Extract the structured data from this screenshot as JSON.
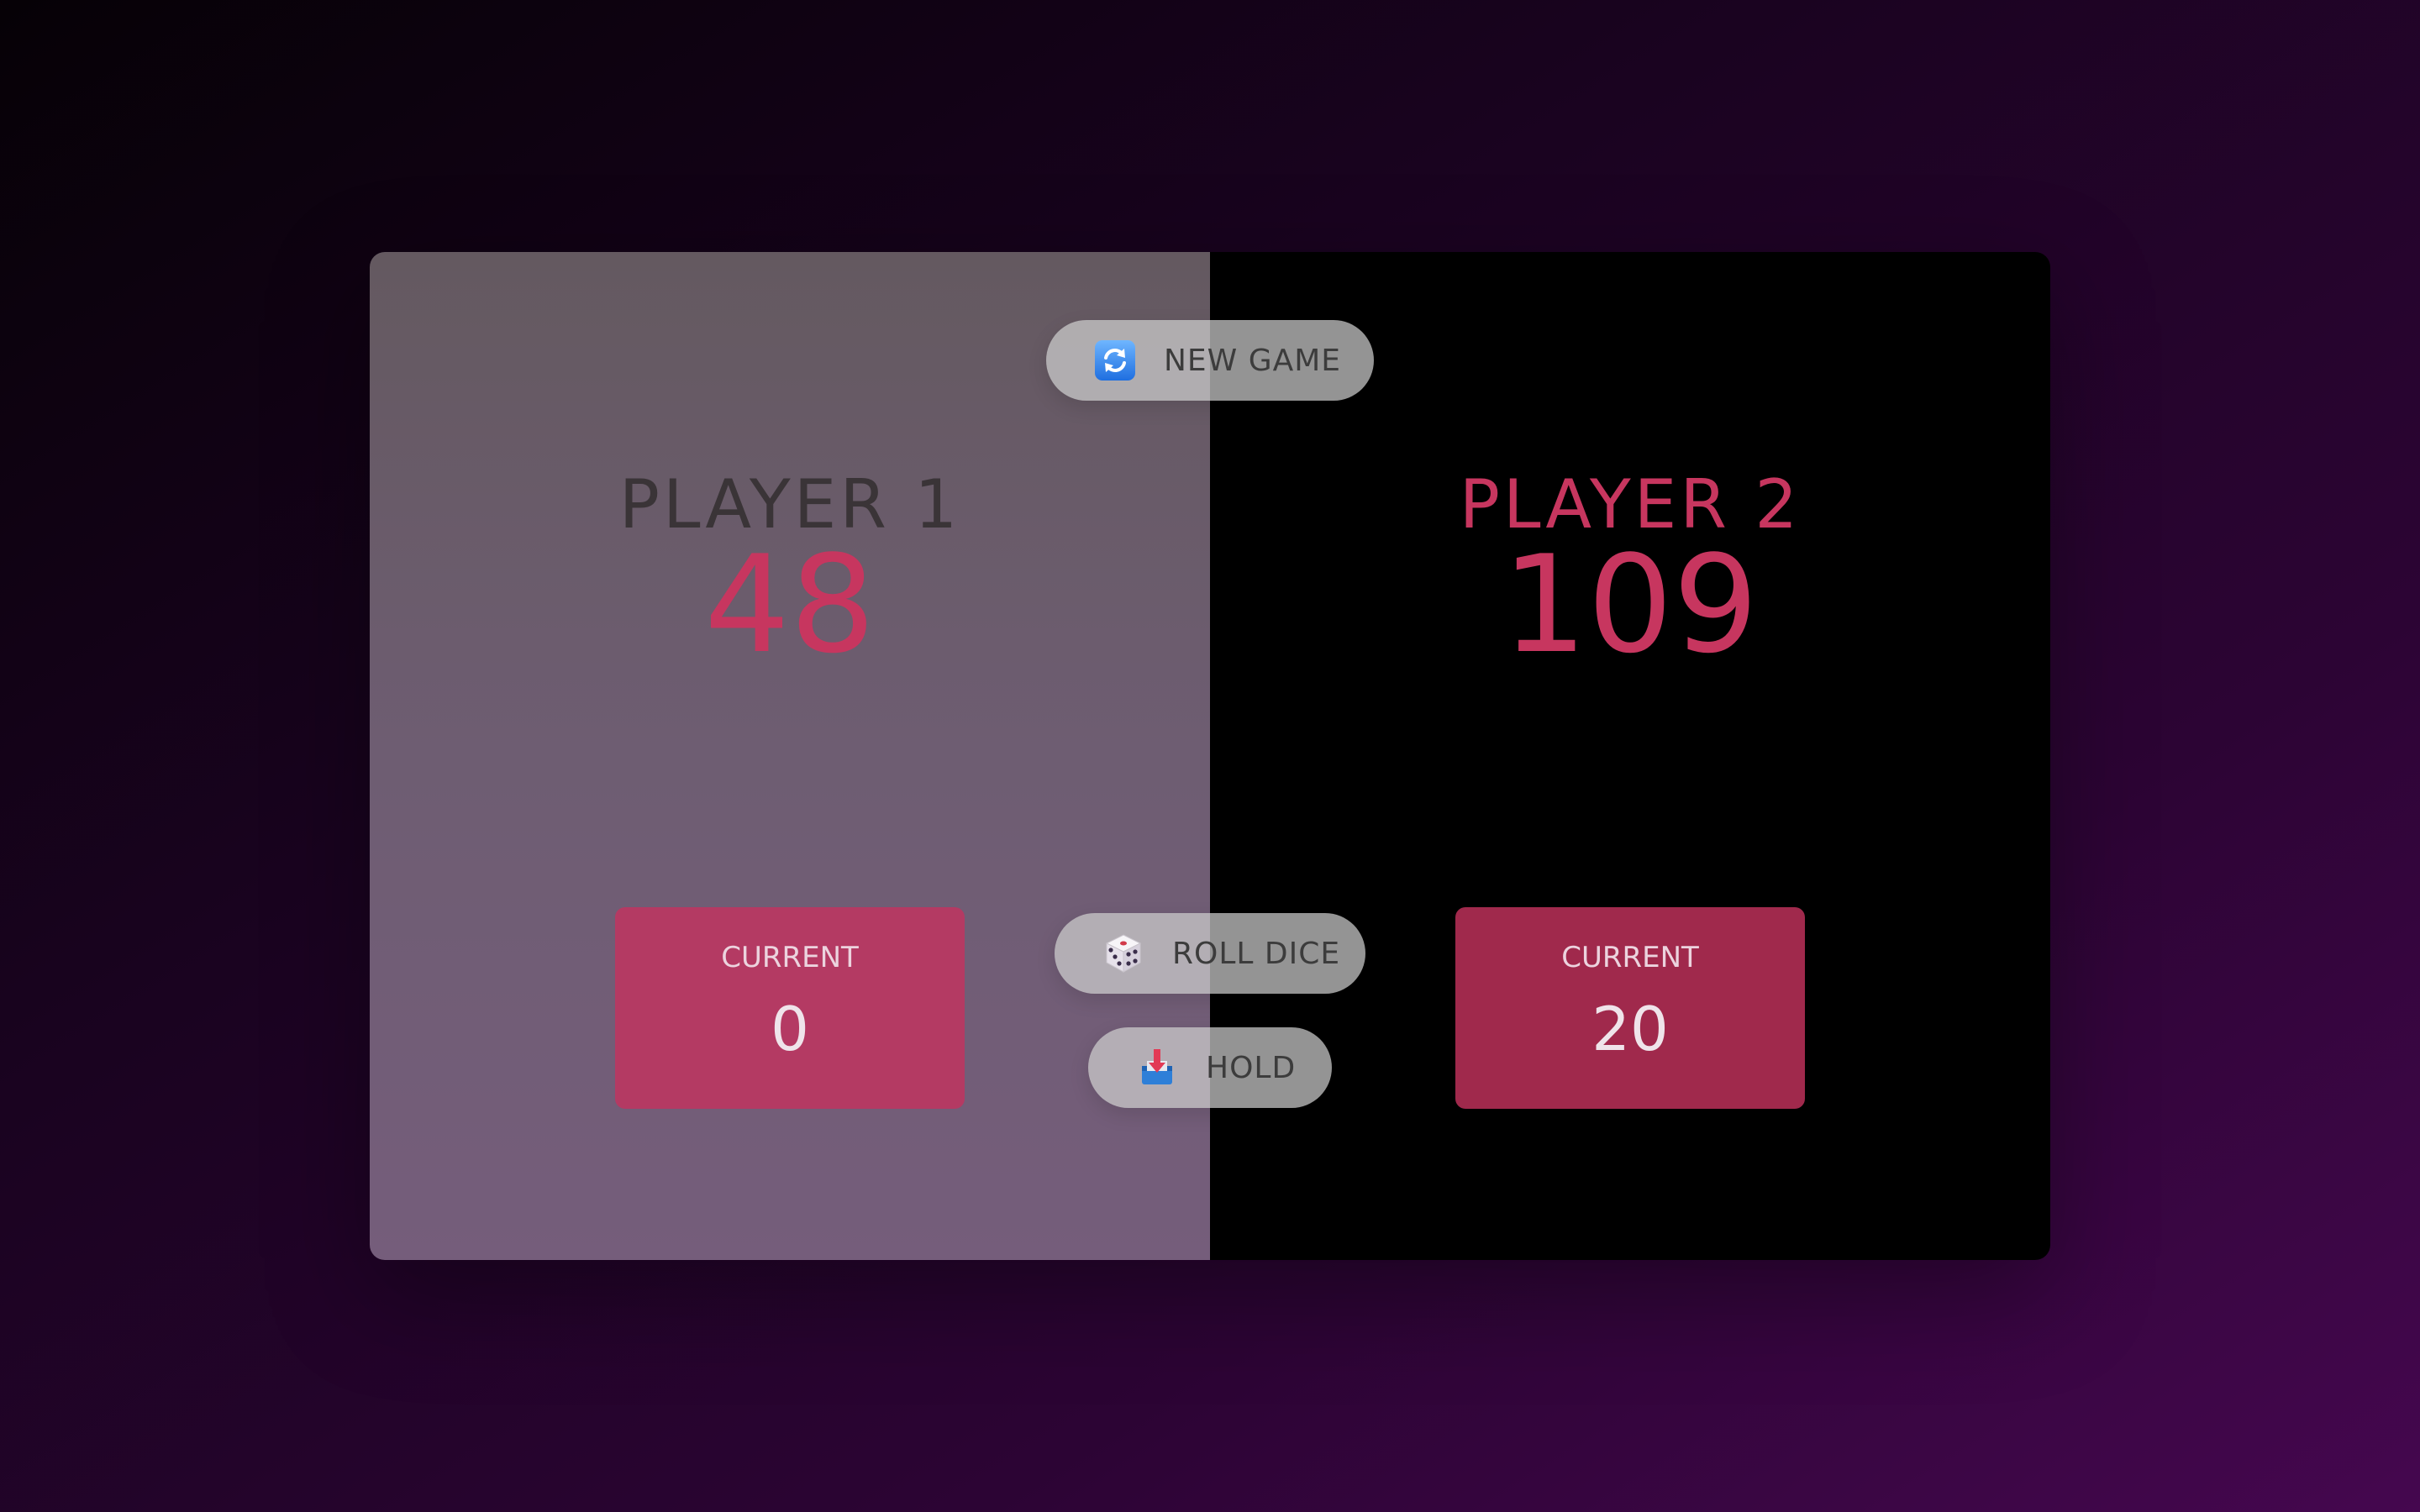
{
  "players": [
    {
      "name": "PLAYER 1",
      "score": "48",
      "current_label": "CURRENT",
      "current_score": "0"
    },
    {
      "name": "PLAYER 2",
      "score": "109",
      "current_label": "CURRENT",
      "current_score": "20"
    }
  ],
  "buttons": {
    "new_game": {
      "label": "NEW GAME",
      "icon": "refresh-icon"
    },
    "roll_dice": {
      "label": "ROLL DICE",
      "icon": "dice-icon"
    },
    "hold": {
      "label": "HOLD",
      "icon": "inbox-download-icon"
    }
  },
  "colors": {
    "accent": "#c7365f",
    "current_box_player1": "#b43a63",
    "current_box_player2": "#a0294c",
    "active_panel_bg": "#6e5d72",
    "inactive_panel_bg": "#000000"
  }
}
